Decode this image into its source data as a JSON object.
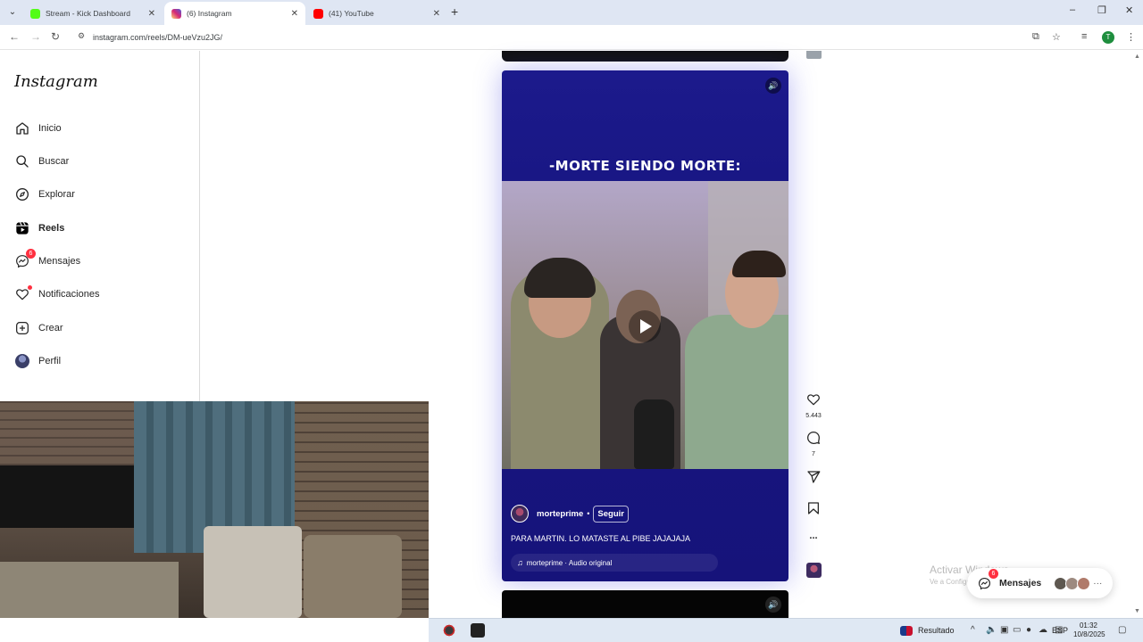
{
  "browser": {
    "tabs": [
      {
        "title": "Stream - Kick Dashboard",
        "favicon_color": "#53fc18"
      },
      {
        "title": "(6) Instagram",
        "favicon_color": "#d62976"
      },
      {
        "title": "(41) YouTube",
        "favicon_color": "#ff0000"
      }
    ],
    "url": "instagram.com/reels/DM-ueVzu2JG/",
    "profile_initial": "T"
  },
  "sidebar": {
    "logo": "Instagram",
    "items": [
      {
        "label": "Inicio",
        "icon": "home-icon"
      },
      {
        "label": "Buscar",
        "icon": "search-icon"
      },
      {
        "label": "Explorar",
        "icon": "compass-icon"
      },
      {
        "label": "Reels",
        "icon": "reels-icon",
        "active": true
      },
      {
        "label": "Mensajes",
        "icon": "messenger-icon",
        "badge": "6"
      },
      {
        "label": "Notificaciones",
        "icon": "heart-icon"
      },
      {
        "label": "Crear",
        "icon": "plus-square-icon"
      },
      {
        "label": "Perfil",
        "icon": "avatar"
      }
    ]
  },
  "reel": {
    "overlay_text": "-MORTE SIENDO MORTE:",
    "username": "morteprime",
    "separator": "•",
    "follow_label": "Seguir",
    "caption": "PARA MARTIN. LO MATASTE AL PIBE JAJAJAJA",
    "audio": "morteprime · Audio original"
  },
  "actions": {
    "likes": "5.443",
    "comments": "7",
    "more": "..."
  },
  "watermark": {
    "title": "Activar Windows",
    "subtitle": "Ve a Configuración para activar Windows."
  },
  "messages_pill": {
    "label": "Mensajes",
    "badge": "6"
  },
  "taskbar": {
    "result_label": "Resultado",
    "language": "ESP",
    "time": "01:32",
    "date": "10/8/2025"
  }
}
